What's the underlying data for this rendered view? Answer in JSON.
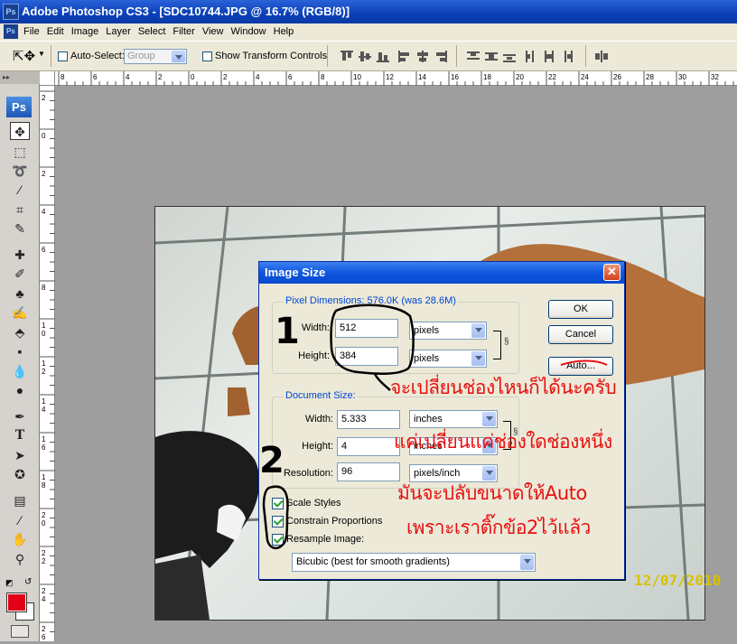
{
  "window": {
    "title": "Adobe Photoshop CS3 - [SDC10744.JPG @ 16.7% (RGB/8)]",
    "app_icon": "Ps"
  },
  "menu": [
    "File",
    "Edit",
    "Image",
    "Layer",
    "Select",
    "Filter",
    "View",
    "Window",
    "Help"
  ],
  "options": {
    "auto_select_label": "Auto-Select:",
    "auto_select_checked": false,
    "group_value": "Group",
    "show_transform_label": "Show Transform Controls",
    "show_transform_checked": false
  },
  "rulers": {
    "h_ticks": [
      "8",
      "6",
      "4",
      "2",
      "0",
      "2",
      "4",
      "6",
      "8",
      "1|0",
      "1|2",
      "1|4",
      "1|6",
      "1|8",
      "2|0",
      "2|2",
      "2|4",
      "2|6",
      "2|8",
      "3|0",
      "3|2"
    ],
    "v_ticks": [
      "2",
      "0",
      "2",
      "4",
      "6",
      "8",
      "1|0",
      "1|2",
      "1|4",
      "1|6",
      "1|8",
      "2|0",
      "2|2",
      "2|4",
      "2|6"
    ]
  },
  "toolbox": {
    "logo": "Ps",
    "colors": {
      "foreground": "#e10015",
      "background": "#ffffff"
    }
  },
  "photo": {
    "date_stamp": "12/07/2010"
  },
  "dialog": {
    "title": "Image Size",
    "pixel_dimensions": {
      "label": "Pixel Dimensions:  576.0K (was 28.6M)",
      "width_label": "Width:",
      "width_value": "512",
      "width_unit": "pixels",
      "height_label": "Height:",
      "height_value": "384",
      "height_unit": "pixels"
    },
    "document_size": {
      "label": "Document Size:",
      "width_label": "Width:",
      "width_value": "5.333",
      "width_unit": "inches",
      "height_label": "Height:",
      "height_value": "4",
      "height_unit": "inches",
      "resolution_label": "Resolution:",
      "resolution_value": "96",
      "resolution_unit": "pixels/inch"
    },
    "buttons": {
      "ok": "OK",
      "cancel": "Cancel",
      "auto": "Auto..."
    },
    "checkboxes": {
      "scale_styles": {
        "label": "Scale Styles",
        "checked": true
      },
      "constrain": {
        "label": "Constrain Proportions",
        "checked": true
      },
      "resample": {
        "label": "Resample Image:",
        "checked": true
      }
    },
    "resample_method": "Bicubic (best for smooth gradients)"
  },
  "annotations": {
    "num1": "1",
    "num2": "2",
    "line1": "จะเปลี่ยนช่องไหนก็ได้นะครับ",
    "line2": "แค่เปลี่ยนแค่ช่องใดช่องหนึ่ง",
    "line3": "มันจะปลับขนาดให้Auto",
    "line4": "เพราะเราติ๊กข้อ2ไว้แล้ว",
    "color": "#e8100f"
  }
}
